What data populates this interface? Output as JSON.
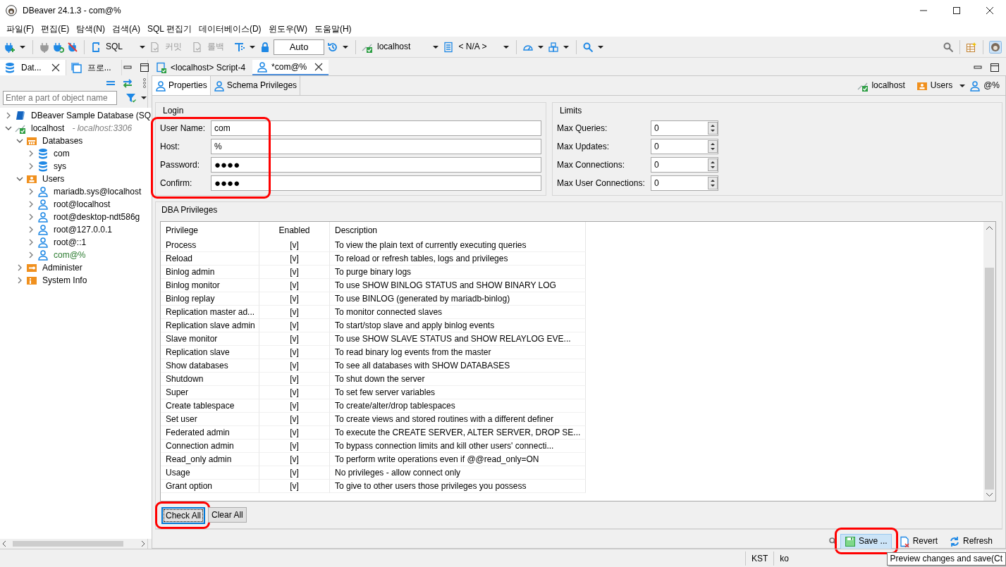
{
  "window": {
    "title": "DBeaver 24.1.3 - com@%"
  },
  "menu": [
    "파일(F)",
    "편집(E)",
    "탐색(N)",
    "검색(A)",
    "SQL 편집기",
    "데이터베이스(D)",
    "윈도우(W)",
    "도움말(H)"
  ],
  "toolbar": {
    "sql": "SQL",
    "commit": {
      "label": "커밋",
      "disabled": true
    },
    "rollback": {
      "label": "롤백",
      "disabled": true
    },
    "transaction_mode": "Auto",
    "datasource": "localhost",
    "schema": "< N/A >"
  },
  "navigator": {
    "tabs": [
      {
        "label": "Dat...",
        "selected": true
      },
      {
        "label": "프로...",
        "selected": false
      }
    ],
    "filter": {
      "placeholder": "Enter a part of object name"
    },
    "tree": [
      {
        "label": "DBeaver Sample Database (SQ",
        "kind": "sample",
        "expanded": false
      },
      {
        "label": "localhost",
        "detail": "- localhost:3306",
        "kind": "connection",
        "expanded": true,
        "children": [
          {
            "label": "Databases",
            "kind": "dbfolder",
            "expanded": true,
            "children": [
              {
                "label": "com",
                "kind": "database",
                "expanded": false
              },
              {
                "label": "sys",
                "kind": "database",
                "expanded": false
              }
            ]
          },
          {
            "label": "Users",
            "kind": "userfolder",
            "expanded": true,
            "children": [
              {
                "label": "mariadb.sys@localhost",
                "kind": "user",
                "expanded": false,
                "modified": false
              },
              {
                "label": "root@localhost",
                "kind": "user",
                "expanded": false,
                "modified": false
              },
              {
                "label": "root@desktop-ndt586g",
                "kind": "user",
                "expanded": false,
                "modified": false
              },
              {
                "label": "root@127.0.0.1",
                "kind": "user",
                "expanded": false,
                "modified": false
              },
              {
                "label": "root@::1",
                "kind": "user",
                "expanded": false,
                "modified": false
              },
              {
                "label": "com@%",
                "kind": "user",
                "expanded": false,
                "modified": true
              }
            ]
          },
          {
            "label": "Administer",
            "kind": "admin",
            "expanded": false
          },
          {
            "label": "System Info",
            "kind": "info",
            "expanded": false
          }
        ]
      }
    ]
  },
  "editor": {
    "tabs": [
      {
        "label": "<localhost> Script-4",
        "selected": false
      },
      {
        "label": "*com@%",
        "selected": true
      }
    ],
    "subtabs": [
      {
        "label": "Properties",
        "selected": true
      },
      {
        "label": "Schema Privileges",
        "selected": false
      }
    ],
    "context": {
      "connection": "localhost",
      "folder": "Users",
      "object": "@%"
    },
    "login": {
      "title": "Login",
      "highlighted": true,
      "fields": [
        {
          "label": "User Name:",
          "value": "com",
          "kind": "text"
        },
        {
          "label": "Host:",
          "value": "%",
          "kind": "text"
        },
        {
          "label": "Password:",
          "value": "●●●●",
          "kind": "password"
        },
        {
          "label": "Confirm:",
          "value": "●●●●",
          "kind": "password"
        }
      ]
    },
    "limits": {
      "title": "Limits",
      "fields": [
        {
          "label": "Max Queries:",
          "value": "0"
        },
        {
          "label": "Max Updates:",
          "value": "0"
        },
        {
          "label": "Max Connections:",
          "value": "0"
        },
        {
          "label": "Max User Connections:",
          "value": "0"
        }
      ]
    },
    "privileges": {
      "title": "DBA Privileges",
      "columns": [
        "Privilege",
        "Enabled",
        "Description"
      ],
      "rows": [
        [
          "Process",
          "[v]",
          "To view the plain text of currently executing queries"
        ],
        [
          "Reload",
          "[v]",
          "To reload or refresh tables, logs and privileges"
        ],
        [
          "Binlog admin",
          "[v]",
          "To purge binary logs"
        ],
        [
          "Binlog monitor",
          "[v]",
          "To use SHOW BINLOG STATUS and SHOW BINARY LOG"
        ],
        [
          "Binlog replay",
          "[v]",
          "To use BINLOG (generated by mariadb-binlog)"
        ],
        [
          "Replication master ad...",
          "[v]",
          "To monitor connected slaves"
        ],
        [
          "Replication slave admin",
          "[v]",
          "To start/stop slave and apply binlog events"
        ],
        [
          "Slave monitor",
          "[v]",
          "To use SHOW SLAVE STATUS and SHOW RELAYLOG EVE..."
        ],
        [
          "Replication slave",
          "[v]",
          "To read binary log events from the master"
        ],
        [
          "Show databases",
          "[v]",
          "To see all databases with SHOW DATABASES"
        ],
        [
          "Shutdown",
          "[v]",
          "To shut down the server"
        ],
        [
          "Super",
          "[v]",
          "To set few server variables"
        ],
        [
          "Create tablespace",
          "[v]",
          "To create/alter/drop tablespaces"
        ],
        [
          "Set user",
          "[v]",
          "To create views and stored routines with a different definer"
        ],
        [
          "Federated admin",
          "[v]",
          "To execute the CREATE SERVER, ALTER SERVER, DROP SE..."
        ],
        [
          "Connection admin",
          "[v]",
          "To bypass connection limits and kill other users' connecti..."
        ],
        [
          "Read_only admin",
          "[v]",
          "To perform write operations even if @@read_only=ON"
        ],
        [
          "Usage",
          "[v]",
          "No privileges - allow connect only"
        ],
        [
          "Grant option",
          "[v]",
          "To give to other users those privileges you possess"
        ]
      ]
    },
    "buttons": [
      {
        "label": "Check All",
        "focused": true,
        "highlighted": true
      },
      {
        "label": "Clear All",
        "focused": false,
        "highlighted": false
      }
    ],
    "actions": [
      {
        "label": "Save ...",
        "kind": "save",
        "hovered": true,
        "highlighted": true
      },
      {
        "label": "Revert",
        "kind": "revert",
        "hovered": false,
        "highlighted": false
      },
      {
        "label": "Refresh",
        "kind": "refresh",
        "hovered": false,
        "highlighted": false
      }
    ]
  },
  "tooltip": "Preview changes and save(Ct",
  "status_bar": [
    "KST",
    "ko"
  ]
}
